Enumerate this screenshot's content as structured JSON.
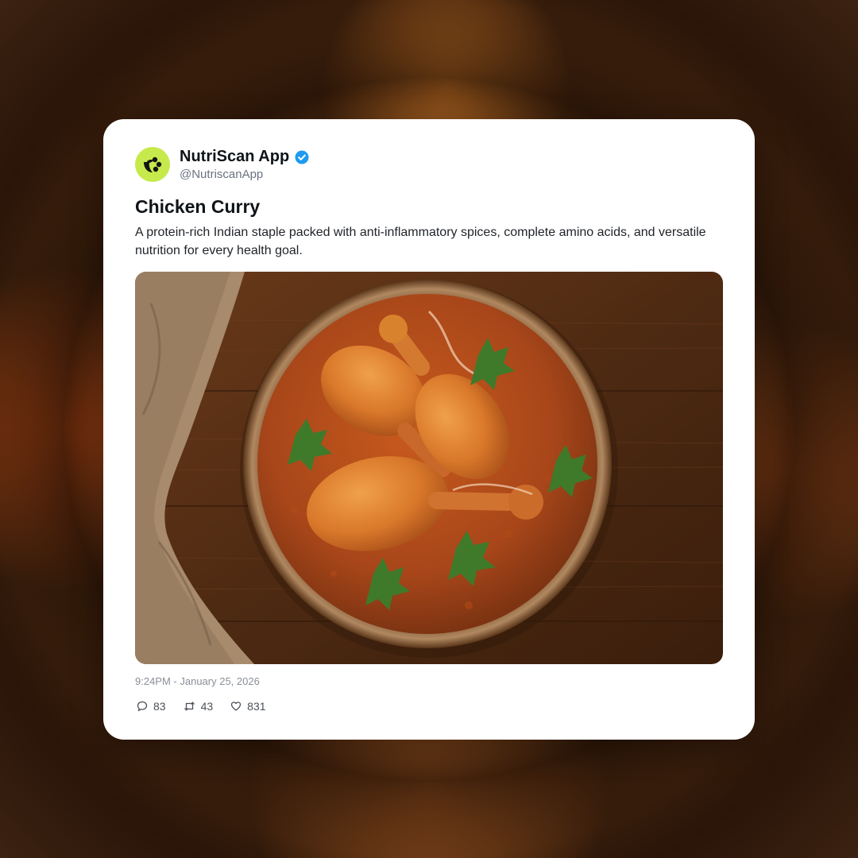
{
  "post": {
    "author_name": "NutriScan App",
    "author_handle": "@NutriscanApp",
    "verified": true,
    "title": "Chicken Curry",
    "description": "A protein-rich Indian staple packed with anti-inflammatory spices, complete amino acids, and versatile nutrition for every health goal.",
    "timestamp": "9:24PM - January 25, 2026",
    "stats": {
      "replies": "83",
      "reposts": "43",
      "likes": "831"
    }
  },
  "icons": {
    "avatar": "nutriscan-logo-icon",
    "verified": "verified-badge-icon",
    "reply": "comment-icon",
    "repost": "repost-icon",
    "like": "heart-icon"
  },
  "colors": {
    "avatar_bg": "#c6ea4b",
    "verified_blue": "#1d9bf0",
    "card_bg": "#ffffff",
    "text_primary": "#0f1419",
    "text_muted": "#6b7280"
  }
}
